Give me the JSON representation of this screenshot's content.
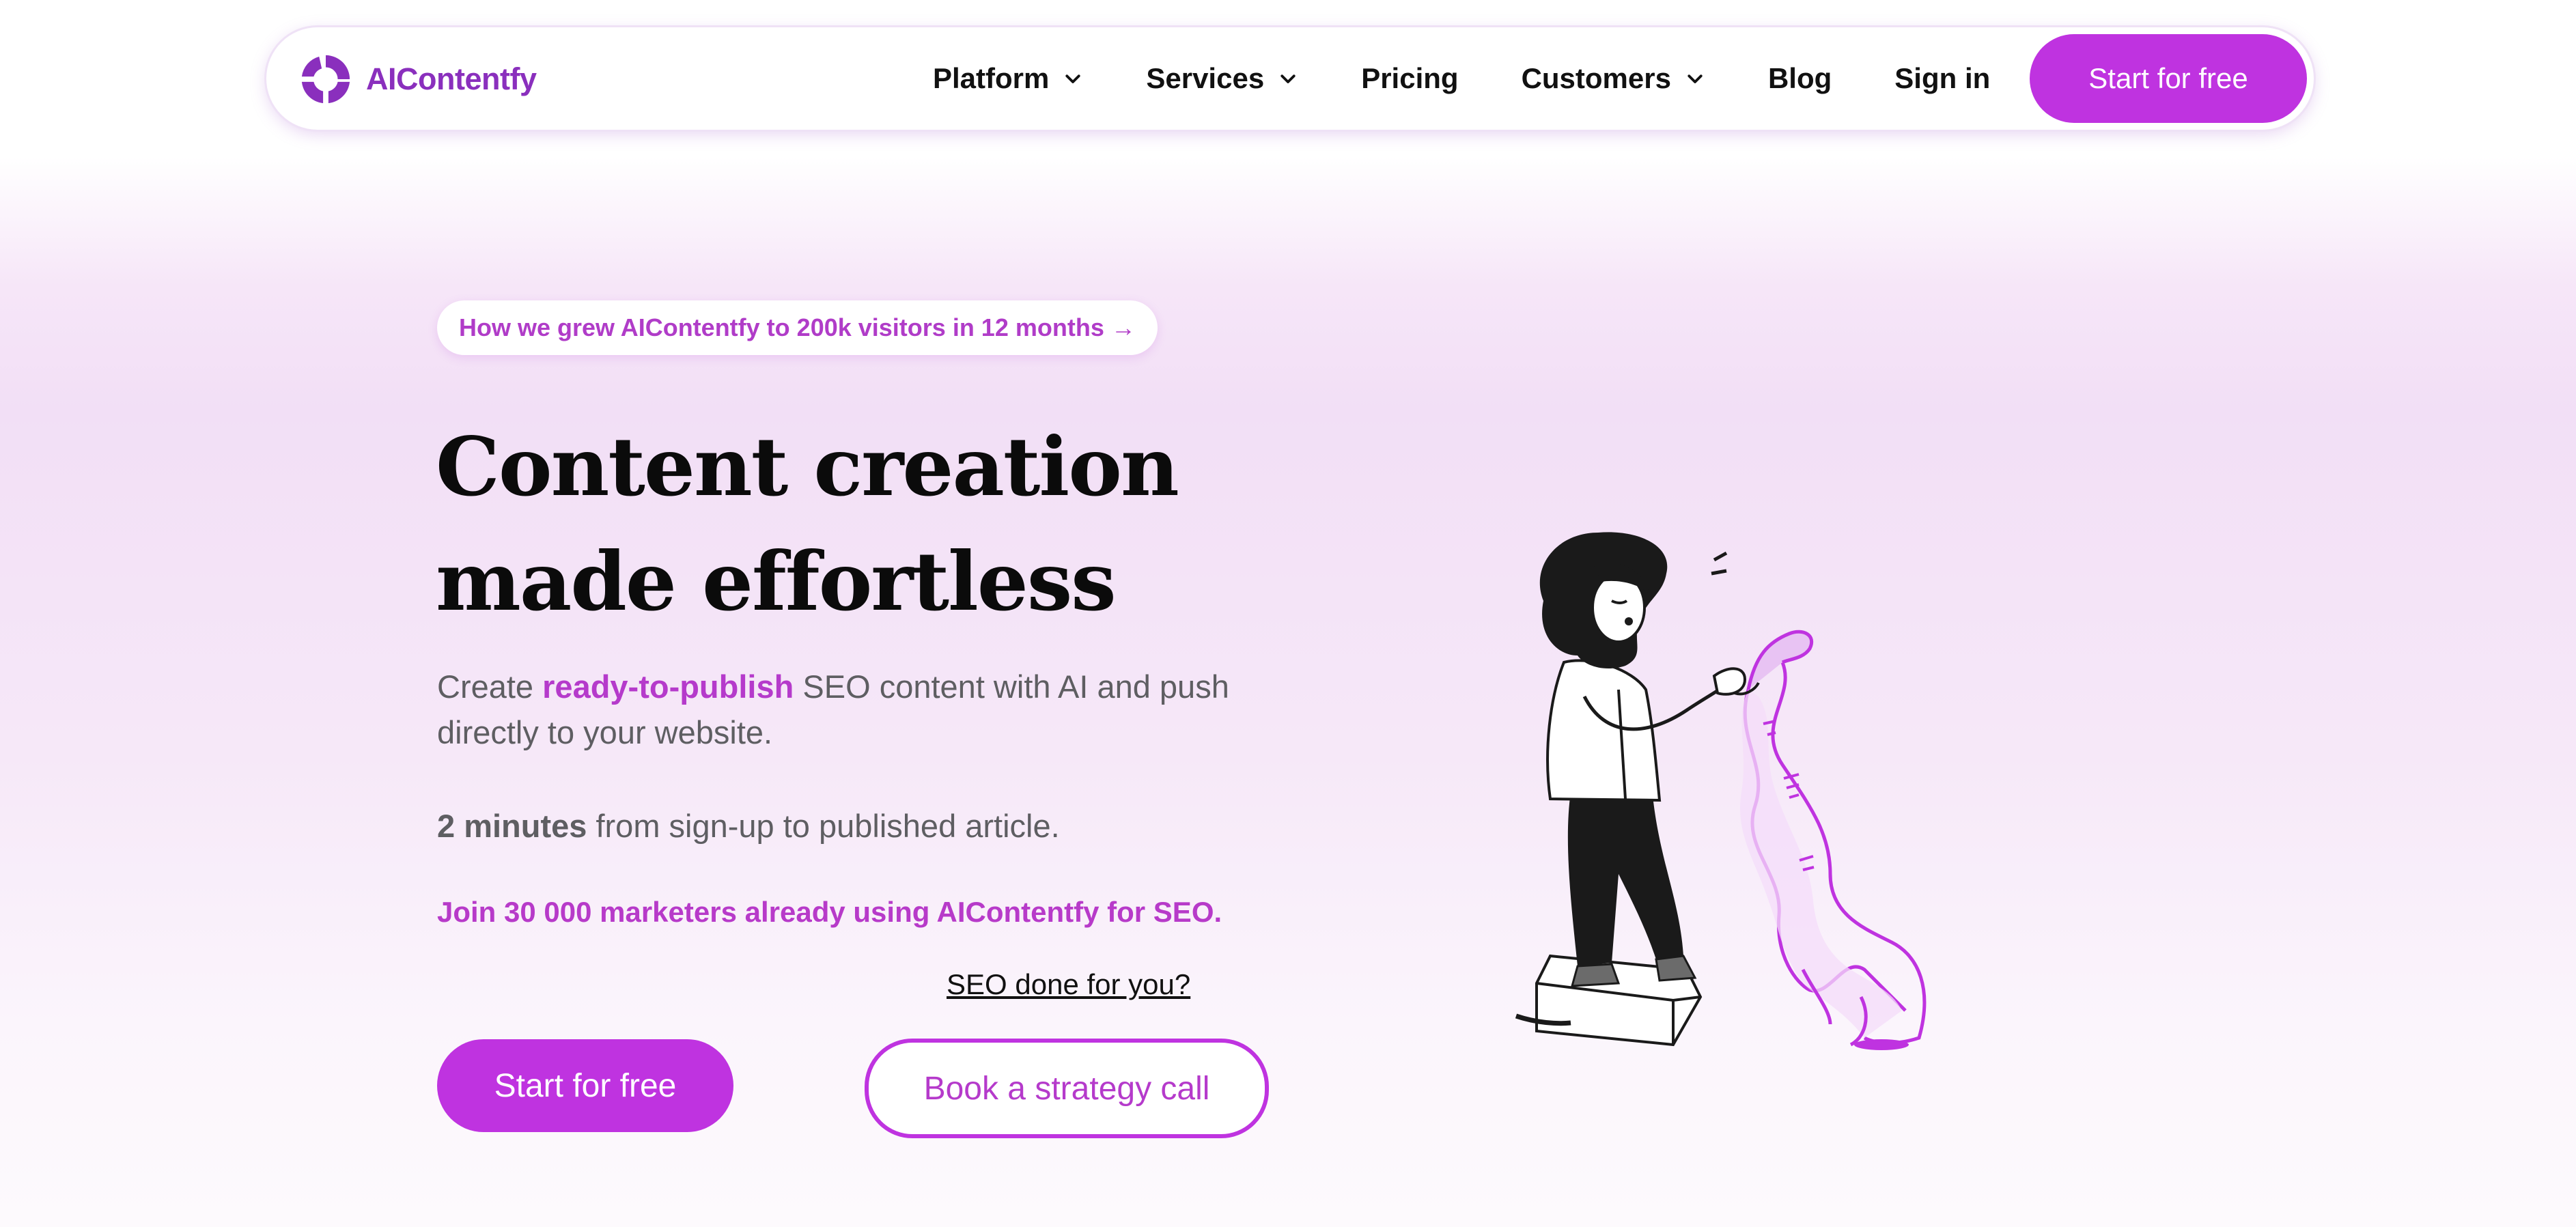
{
  "nav": {
    "brand": "AIContentfy",
    "items": [
      {
        "label": "Platform",
        "has_dropdown": true
      },
      {
        "label": "Services",
        "has_dropdown": true
      },
      {
        "label": "Pricing",
        "has_dropdown": false
      },
      {
        "label": "Customers",
        "has_dropdown": true
      },
      {
        "label": "Blog",
        "has_dropdown": false
      },
      {
        "label": "Sign in",
        "has_dropdown": false
      }
    ],
    "cta": "Start for free"
  },
  "hero": {
    "announcement": "How we grew AIContentfy to 200k visitors in 12 months →",
    "title": "Content creation made effortless",
    "subtitle_pre": "Create ",
    "subtitle_highlight": "ready-to-publish",
    "subtitle_post": " SEO content with AI and push directly to your website.",
    "stat_bold": "2 minutes",
    "stat_rest": " from sign-up to published article.",
    "social_proof": "Join 30 000 marketers already using AIContentfy for SEO.",
    "secondary_link": "SEO done for you?",
    "primary_button": "Start for free",
    "secondary_button": "Book a strategy call"
  },
  "colors": {
    "accent": "#bf33e0",
    "accent_text": "#b53acb",
    "brand": "#8a2fbd"
  },
  "icons": [
    "logo-mark-icon",
    "chevron-down-icon",
    "woman-reading-scroll-illustration"
  ]
}
